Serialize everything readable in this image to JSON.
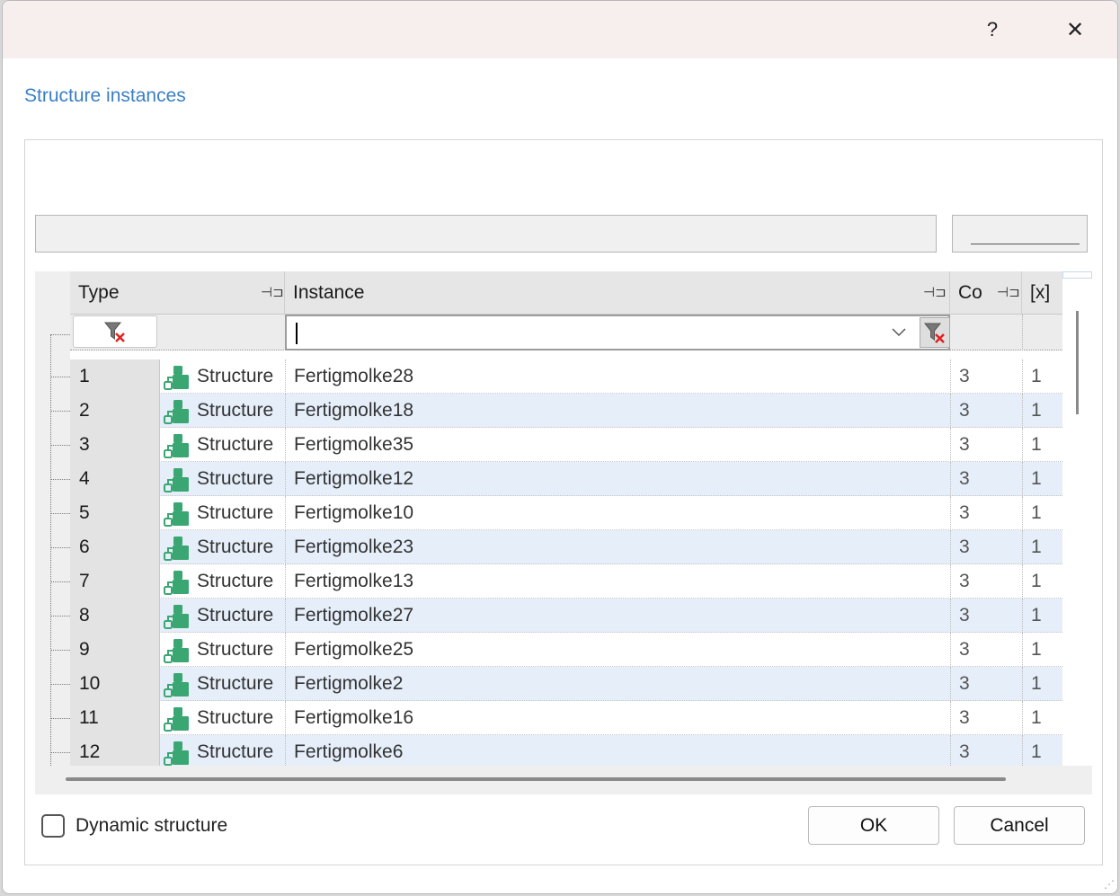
{
  "titlebar": {
    "help_label": "?",
    "close_label": "✕"
  },
  "section_title": "Structure instances",
  "grid": {
    "columns": [
      {
        "label": "Type"
      },
      {
        "label": "Instance"
      },
      {
        "label": "Co"
      },
      {
        "label": "[x]"
      }
    ],
    "filter": {
      "value": "",
      "dropdown_icon": "chevron-down-icon"
    },
    "rows": [
      {
        "num": "1",
        "type": "Structure",
        "instance": "Fertigmolke28",
        "co": "3",
        "x": "1"
      },
      {
        "num": "2",
        "type": "Structure",
        "instance": "Fertigmolke18",
        "co": "3",
        "x": "1"
      },
      {
        "num": "3",
        "type": "Structure",
        "instance": "Fertigmolke35",
        "co": "3",
        "x": "1"
      },
      {
        "num": "4",
        "type": "Structure",
        "instance": "Fertigmolke12",
        "co": "3",
        "x": "1"
      },
      {
        "num": "5",
        "type": "Structure",
        "instance": "Fertigmolke10",
        "co": "3",
        "x": "1"
      },
      {
        "num": "6",
        "type": "Structure",
        "instance": "Fertigmolke23",
        "co": "3",
        "x": "1"
      },
      {
        "num": "7",
        "type": "Structure",
        "instance": "Fertigmolke13",
        "co": "3",
        "x": "1"
      },
      {
        "num": "8",
        "type": "Structure",
        "instance": "Fertigmolke27",
        "co": "3",
        "x": "1"
      },
      {
        "num": "9",
        "type": "Structure",
        "instance": "Fertigmolke25",
        "co": "3",
        "x": "1"
      },
      {
        "num": "10",
        "type": "Structure",
        "instance": "Fertigmolke2",
        "co": "3",
        "x": "1"
      },
      {
        "num": "11",
        "type": "Structure",
        "instance": "Fertigmolke16",
        "co": "3",
        "x": "1"
      },
      {
        "num": "12",
        "type": "Structure",
        "instance": "Fertigmolke6",
        "co": "3",
        "x": "1"
      }
    ]
  },
  "footer": {
    "dynamic_structure_label": "Dynamic structure",
    "dynamic_structure_checked": false,
    "ok_label": "OK",
    "cancel_label": "Cancel"
  },
  "colors": {
    "accent": "#3b7fc4",
    "row_alt": "#e5eef9",
    "structure_icon": "#3aa772"
  }
}
